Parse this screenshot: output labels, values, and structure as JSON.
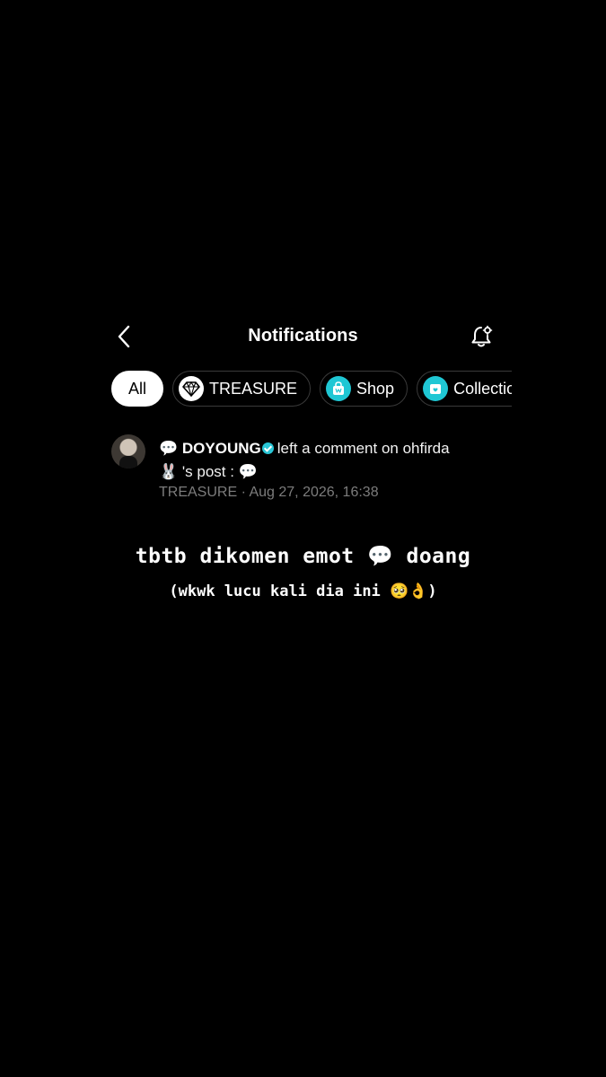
{
  "header": {
    "title": "Notifications",
    "back_icon": "chevron-left-icon",
    "settings_icon": "bell-settings-icon"
  },
  "tabs": [
    {
      "label": "All",
      "active": true
    },
    {
      "label": "TREASURE",
      "icon": "treasure-diamond-icon"
    },
    {
      "label": "Shop",
      "icon": "shop-bag-icon"
    },
    {
      "label": "Collectio",
      "icon": "collection-box-icon"
    }
  ],
  "notification": {
    "prefix_emoji": "💬",
    "user": "DOYOUNG",
    "action": "left a comment on ohfirda",
    "target_emoji": "🐰",
    "post_text": "'s post :",
    "suffix_emoji": "💬",
    "community": "TREASURE",
    "separator": "·",
    "timestamp": "Aug 27, 2026, 16:38"
  },
  "caption": {
    "line1": "tbtb dikomen emot 💬 doang",
    "line2": "(wkwk lucu kali dia ini 🥺👌)"
  },
  "colors": {
    "background": "#000000",
    "accent": "#1fc7d4",
    "meta_text": "#7c7c7c"
  }
}
